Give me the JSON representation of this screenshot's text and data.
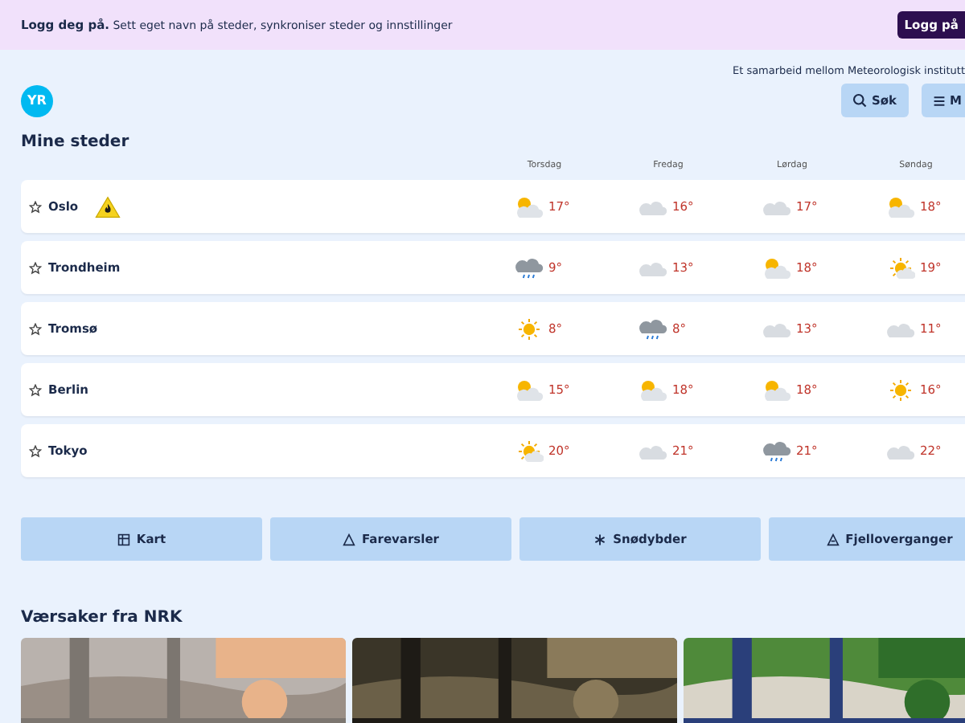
{
  "login_banner": {
    "title": "Logg deg på.",
    "text": "Sett eget navn på steder, synkroniser steder og innstillinger",
    "button": "Logg på"
  },
  "header": {
    "tagline": "Et samarbeid mellom Meteorologisk institutt",
    "logo": "YR",
    "search_button": "Søk",
    "menu_button": "M"
  },
  "places": {
    "title": "Mine steder",
    "days": [
      "Torsdag",
      "Fredag",
      "Lørdag",
      "Søndag"
    ],
    "rows": [
      {
        "name": "Oslo",
        "warning": true,
        "forecast": [
          {
            "kind": "partly_cloudy",
            "temp": "17°"
          },
          {
            "kind": "cloudy",
            "temp": "16°"
          },
          {
            "kind": "cloudy",
            "temp": "17°"
          },
          {
            "kind": "partly_cloudy",
            "temp": "18°"
          }
        ]
      },
      {
        "name": "Trondheim",
        "warning": false,
        "forecast": [
          {
            "kind": "rain",
            "temp": "9°"
          },
          {
            "kind": "cloudy",
            "temp": "13°"
          },
          {
            "kind": "partly_cloudy",
            "temp": "18°"
          },
          {
            "kind": "fair",
            "temp": "19°"
          }
        ]
      },
      {
        "name": "Tromsø",
        "warning": false,
        "forecast": [
          {
            "kind": "sun",
            "temp": "8°"
          },
          {
            "kind": "rain",
            "temp": "8°"
          },
          {
            "kind": "cloudy",
            "temp": "13°"
          },
          {
            "kind": "cloudy",
            "temp": "11°"
          }
        ]
      },
      {
        "name": "Berlin",
        "warning": false,
        "forecast": [
          {
            "kind": "partly_cloudy",
            "temp": "15°"
          },
          {
            "kind": "partly_cloudy",
            "temp": "18°"
          },
          {
            "kind": "partly_cloudy",
            "temp": "18°"
          },
          {
            "kind": "sun",
            "temp": "16°"
          }
        ]
      },
      {
        "name": "Tokyo",
        "warning": false,
        "forecast": [
          {
            "kind": "fair",
            "temp": "20°"
          },
          {
            "kind": "cloudy",
            "temp": "21°"
          },
          {
            "kind": "rain",
            "temp": "21°"
          },
          {
            "kind": "cloudy",
            "temp": "22°"
          }
        ]
      }
    ]
  },
  "quick_links": [
    {
      "kind": "map",
      "label": "Kart"
    },
    {
      "kind": "warning",
      "label": "Farevarsler"
    },
    {
      "kind": "snow",
      "label": "Snødybder"
    },
    {
      "kind": "mountain",
      "label": "Fjelloverganger"
    }
  ],
  "news": {
    "title": "Værsaker fra NRK"
  }
}
